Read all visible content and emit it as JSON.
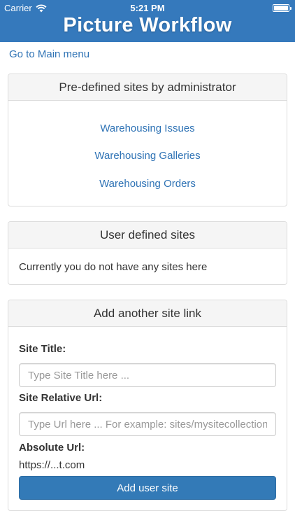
{
  "status_bar": {
    "carrier": "Carrier",
    "time": "5:21 PM"
  },
  "header": {
    "title": "Picture Workflow"
  },
  "nav": {
    "main_menu_link": "Go to Main menu"
  },
  "predefined_sites": {
    "heading": "Pre-defined sites by administrator",
    "links": [
      "Warehousing Issues",
      "Warehousing Galleries",
      "Warehousing Orders"
    ]
  },
  "user_sites": {
    "heading": "User defined sites",
    "empty_message": "Currently you do not have any sites here"
  },
  "add_site": {
    "heading": "Add another site link",
    "title_label": "Site Title:",
    "title_placeholder": "Type Site Title here ...",
    "url_label": "Site Relative Url:",
    "url_placeholder": "Type Url here ... For example: sites/mysitecollection",
    "absolute_label": "Absolute Url:",
    "absolute_value": "https://...t.com",
    "submit_label": "Add user site"
  },
  "colors": {
    "header_bg": "#3579bc",
    "link": "#2f73b5",
    "button_bg": "#337ab7",
    "panel_heading_bg": "#f5f5f5"
  },
  "icons": {
    "wifi": "wifi-icon",
    "battery": "battery-icon"
  }
}
